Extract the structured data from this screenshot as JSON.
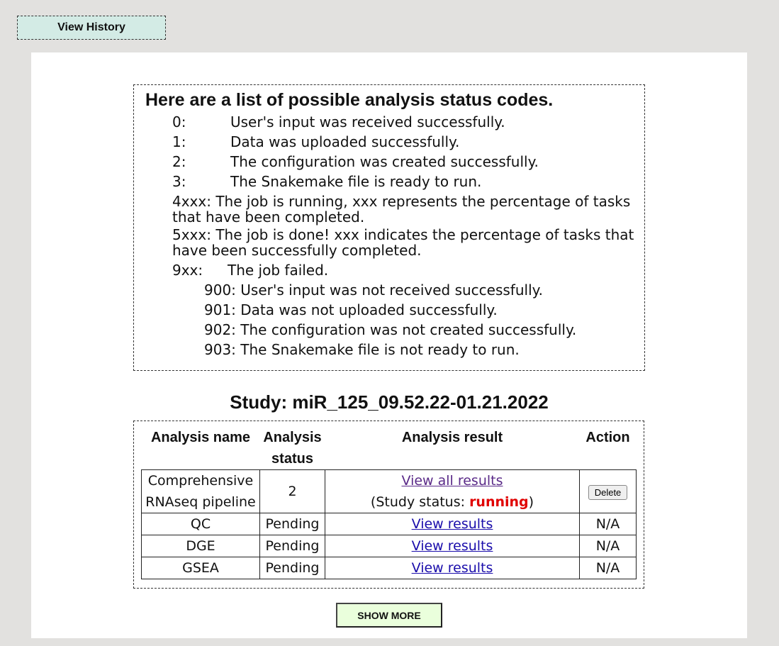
{
  "header": {
    "view_history_label": "View History"
  },
  "codes": {
    "title": "Here are a list of possible analysis status codes.",
    "rows": [
      {
        "code": "0:",
        "desc": "User's input was received successfully."
      },
      {
        "code": "1:",
        "desc": "Data was uploaded successfully."
      },
      {
        "code": "2:",
        "desc": "The configuration was created successfully."
      },
      {
        "code": "3:",
        "desc": "The Snakemake file is ready to run."
      }
    ],
    "running": "4xxx:  The job is running, xxx represents the percentage of tasks that have been completed.",
    "done": "5xxx:  The job is done! xxx indicates the percentage of tasks that have been successfully completed.",
    "failed_code": "9xx:",
    "failed_desc": "The job failed.",
    "failed_subs": [
      "900: User's input was not received successfully.",
      "901: Data was not uploaded successfully.",
      "902: The configuration was not created successfully.",
      "903: The Snakemake file is not ready to run."
    ]
  },
  "study": {
    "title": "Study: miR_125_09.52.22-01.21.2022",
    "columns": [
      "Analysis name",
      "Analysis status",
      "Analysis result",
      "Action"
    ],
    "main_row": {
      "name": "Comprehensive RNAseq pipeline",
      "status": "2",
      "link": "View all results",
      "study_status_prefix": "(Study status: ",
      "study_status_value": "running",
      "study_status_suffix": ")",
      "action": "Delete"
    },
    "rows": [
      {
        "name": "QC",
        "status": "Pending",
        "link": "View results",
        "action": "N/A"
      },
      {
        "name": "DGE",
        "status": "Pending",
        "link": "View results",
        "action": "N/A"
      },
      {
        "name": "GSEA",
        "status": "Pending",
        "link": "View results",
        "action": "N/A"
      }
    ]
  },
  "footer": {
    "show_more_label": "SHOW MORE"
  },
  "colors": {
    "running": "#e00000",
    "link": "#1a0dab",
    "visited_link": "#5a2a88"
  }
}
